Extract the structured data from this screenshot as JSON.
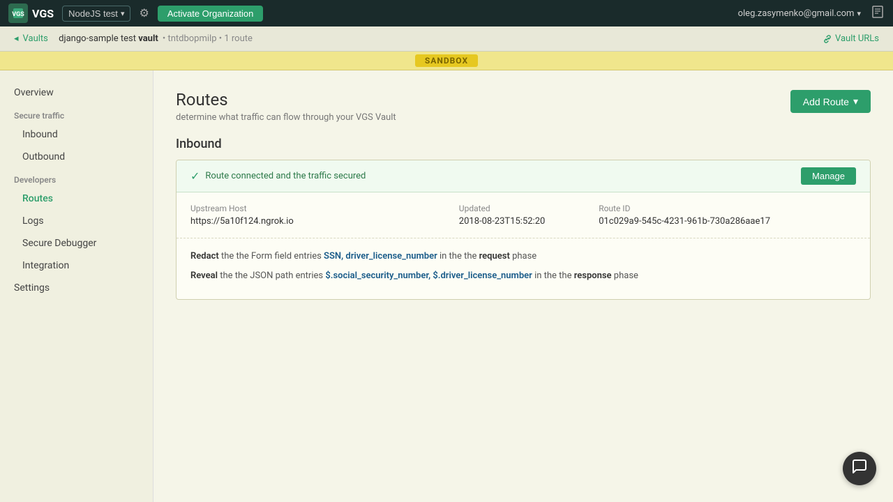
{
  "topnav": {
    "logo_text": "VGS",
    "node_selector_label": "NodeJS test",
    "activate_btn_label": "Activate Organization",
    "user_email": "oleg.zasymenko@gmail.com",
    "gear_icon": "⚙",
    "book_icon": "📖",
    "chevron_down": "▾"
  },
  "breadcrumb": {
    "vaults_label": "Vaults",
    "vault_name": "django-sample test",
    "vault_suffix": "vault",
    "vault_id": "tntdbopmilp",
    "route_count": "1 route",
    "vault_urls_label": "Vault URLs",
    "link_icon": "🔗",
    "back_arrow": "◂"
  },
  "sandbox": {
    "badge_label": "SANDBOX"
  },
  "sidebar": {
    "overview_label": "Overview",
    "secure_traffic_label": "Secure traffic",
    "inbound_label": "Inbound",
    "outbound_label": "Outbound",
    "developers_label": "Developers",
    "routes_label": "Routes",
    "logs_label": "Logs",
    "secure_debugger_label": "Secure Debugger",
    "integration_label": "Integration",
    "settings_label": "Settings"
  },
  "routes_page": {
    "title": "Routes",
    "subtitle": "determine what traffic can flow through your VGS Vault",
    "add_route_label": "Add Route",
    "chevron": "▾",
    "inbound_heading": "Inbound",
    "route_card": {
      "status_text": "Route connected and the traffic secured",
      "manage_btn_label": "Manage",
      "upstream_host_label": "Upstream Host",
      "upstream_host_value": "https://5a10f124.ngrok.io",
      "updated_label": "Updated",
      "updated_value": "2018-08-23T15:52:20",
      "route_id_label": "Route ID",
      "route_id_value": "01c029a9-545c-4231-961b-730a286aae17",
      "filter1_keyword": "Redact",
      "filter1_type": "the Form field entries",
      "filter1_fields": "SSN, driver_license_number",
      "filter1_in": "in the",
      "filter1_phase_label": "request",
      "filter1_phase_suffix": "phase",
      "filter2_keyword": "Reveal",
      "filter2_type": "the JSON path entries",
      "filter2_fields": "$.social_security_number, $.driver_license_number",
      "filter2_in": "in the",
      "filter2_phase_label": "response",
      "filter2_phase_suffix": "phase"
    }
  }
}
